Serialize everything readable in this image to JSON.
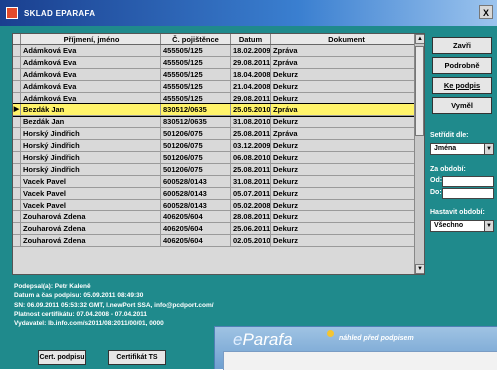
{
  "window": {
    "title": "SKLAD EPARAFA",
    "close_label": "X"
  },
  "grid": {
    "columns": [
      "Příjmení, jméno",
      "Č. pojištěnce",
      "Datum",
      "Dokument"
    ],
    "rows": [
      {
        "name": "Adámková Eva",
        "id": "455505/125",
        "date": "18.02.2009",
        "doc": "Zpráva",
        "selected": false
      },
      {
        "name": "Adámková Eva",
        "id": "455505/125",
        "date": "29.08.2011",
        "doc": "Zpráva",
        "selected": false
      },
      {
        "name": "Adámková Eva",
        "id": "455505/125",
        "date": "18.04.2008",
        "doc": "Dekurz",
        "selected": false
      },
      {
        "name": "Adámková Eva",
        "id": "455505/125",
        "date": "21.04.2008",
        "doc": "Dekurz",
        "selected": false
      },
      {
        "name": "Adámková Eva",
        "id": "455505/125",
        "date": "29.08.2011",
        "doc": "Dekurz",
        "selected": false
      },
      {
        "name": "Bezdák Jan",
        "id": "830512/0635",
        "date": "25.05.2010",
        "doc": "Zpráva",
        "selected": true
      },
      {
        "name": "Bezdák Jan",
        "id": "830512/0635",
        "date": "31.08.2010",
        "doc": "Dekurz",
        "selected": false
      },
      {
        "name": "Horský Jindřich",
        "id": "501206/075",
        "date": "25.08.2011",
        "doc": "Zpráva",
        "selected": false
      },
      {
        "name": "Horský Jindřich",
        "id": "501206/075",
        "date": "03.12.2009",
        "doc": "Dekurz",
        "selected": false
      },
      {
        "name": "Horský Jindřich",
        "id": "501206/075",
        "date": "06.08.2010",
        "doc": "Dekurz",
        "selected": false
      },
      {
        "name": "Horský Jindřich",
        "id": "501206/075",
        "date": "25.08.2011",
        "doc": "Dekurz",
        "selected": false
      },
      {
        "name": "Vacek Pavel",
        "id": "600528/0143",
        "date": "31.08.2011",
        "doc": "Dekurz",
        "selected": false
      },
      {
        "name": "Vacek Pavel",
        "id": "600528/0143",
        "date": "05.07.2011",
        "doc": "Dekurz",
        "selected": false
      },
      {
        "name": "Vacek Pavel",
        "id": "600528/0143",
        "date": "05.02.2008",
        "doc": "Dekurz",
        "selected": false
      },
      {
        "name": "Zouharová Zdena",
        "id": "406205/604",
        "date": "28.08.2011",
        "doc": "Dekurz",
        "selected": false
      },
      {
        "name": "Zouharová Zdena",
        "id": "406205/604",
        "date": "25.06.2011",
        "doc": "Dekurz",
        "selected": false
      },
      {
        "name": "Zouharová Zdena",
        "id": "406205/604",
        "date": "02.05.2010",
        "doc": "Dekurz",
        "selected": false
      }
    ]
  },
  "side": {
    "btn_close": "Zavři",
    "btn_detail": "Podrobně",
    "btn_signature": "Ke podpis",
    "btn_print": "Vyměl",
    "sort_label": "Setřídit dle:",
    "sort_value": "Jména",
    "period_label": "Za období:",
    "from_label": "Od:",
    "to_label": "Do:",
    "filter_label": "Hastavit období:",
    "filter_value": "Všechno"
  },
  "info": {
    "lines": [
      "Podepsal(a): Petr Kaleně",
      "Datum a čas podpisu: 05.09.2011 08:49:30",
      "SN: 06.09.2011 05:53:32 GMT, I.newPort SSA, info@pcdport.com/",
      "Platnost certifikátu: 07.04.2008 - 07.04.2011",
      "Vydavatel: Ib.info.com/s2011/08:2011/00/01, 0000"
    ]
  },
  "bottom": {
    "btn_cert_sign": "Cert. podpisu",
    "btn_cert_ts": "Certifikát TS"
  },
  "overlay": {
    "logo_e": "e",
    "logo_text": "Parafa",
    "subtitle": "náhled před podpisem"
  }
}
